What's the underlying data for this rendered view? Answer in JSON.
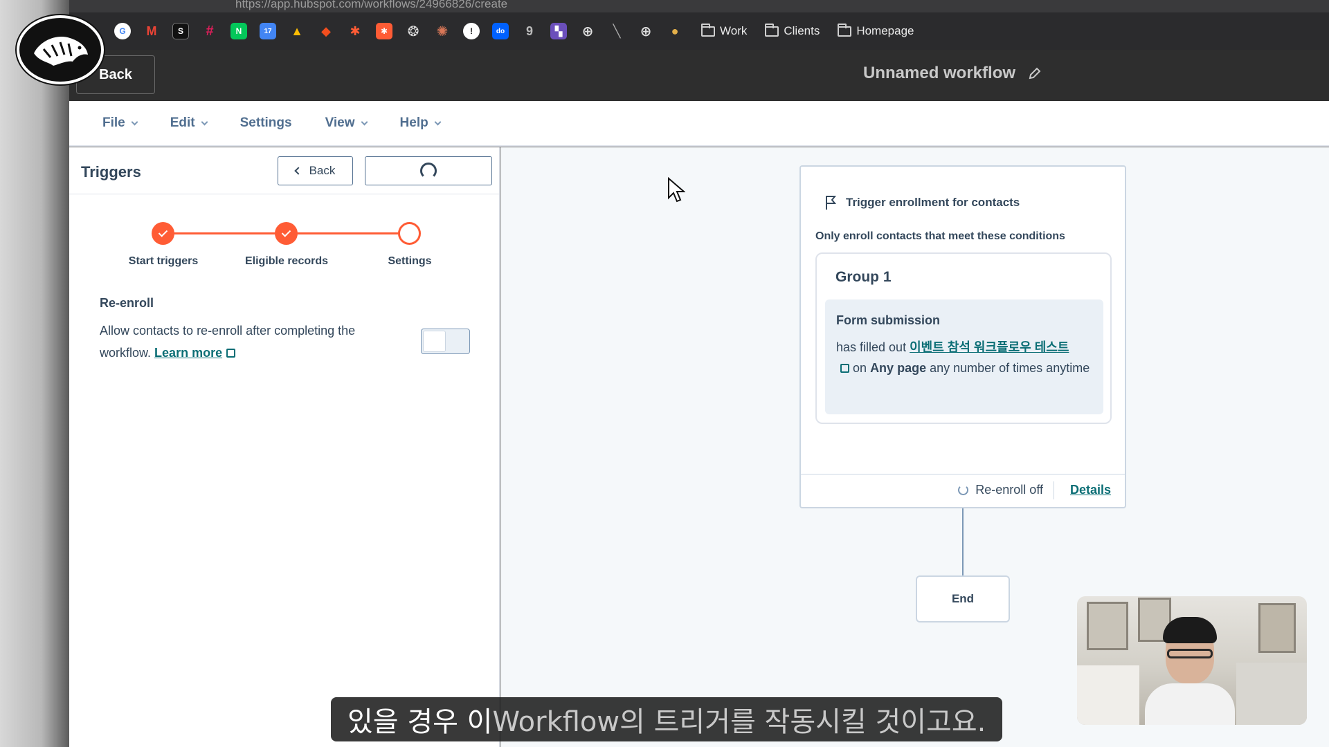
{
  "browser": {
    "url": "https://app.hubspot.com/workflows/24966826/create",
    "bookmark_folders": [
      "Work",
      "Clients",
      "Homepage"
    ]
  },
  "header": {
    "back_label": "Back",
    "workflow_title": "Unnamed workflow"
  },
  "menu": {
    "items": [
      "File",
      "Edit",
      "Settings",
      "View",
      "Help"
    ]
  },
  "panel": {
    "title": "Triggers",
    "back_label": "Back",
    "steps": [
      {
        "label": "Start triggers",
        "state": "done"
      },
      {
        "label": "Eligible records",
        "state": "done"
      },
      {
        "label": "Settings",
        "state": "current"
      }
    ],
    "reenroll": {
      "title": "Re-enroll",
      "description": "Allow contacts to re-enroll after completing the workflow.",
      "learn_more": "Learn more",
      "toggle_on": false
    }
  },
  "trigger_card": {
    "heading": "Trigger enrollment for contacts",
    "subheading": "Only enroll contacts that meet these conditions",
    "group_title": "Group 1",
    "filter_title": "Form submission",
    "filter_prefix": "has filled out",
    "form_name": "이벤트 참석 워크플로우 테스트",
    "filter_on": "on",
    "filter_page": "Any page",
    "filter_suffix": "any number of times anytime",
    "reenroll_status": "Re-enroll off",
    "details_label": "Details"
  },
  "end_node": {
    "label": "End"
  },
  "subtitle": {
    "part1": "있을 경우 이",
    "part2": " Workflow의 트리거를 작동시킬 것이고요."
  },
  "colors": {
    "accent_orange": "#ff5c35",
    "link_teal": "#0b6e75",
    "header_dark": "#2e2e2e"
  }
}
